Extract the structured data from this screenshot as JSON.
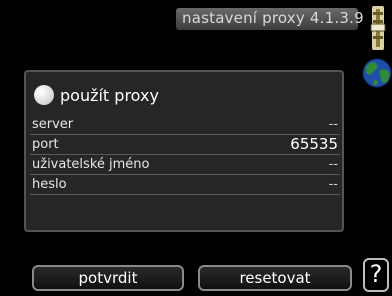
{
  "header": {
    "title": "nastavení proxy 4.1.3.9"
  },
  "icons": {
    "thermostat": "thermometer-slider-icon",
    "globe": "globe-icon",
    "help": "?"
  },
  "proxy": {
    "toggle_label": "použít proxy",
    "rows": [
      {
        "label": "server",
        "value": "--"
      },
      {
        "label": "port",
        "value": "65535"
      },
      {
        "label": "uživatelské jméno",
        "value": "--"
      },
      {
        "label": "heslo",
        "value": "--"
      }
    ]
  },
  "buttons": {
    "confirm": "potvrdit",
    "reset": "resetovat"
  }
}
